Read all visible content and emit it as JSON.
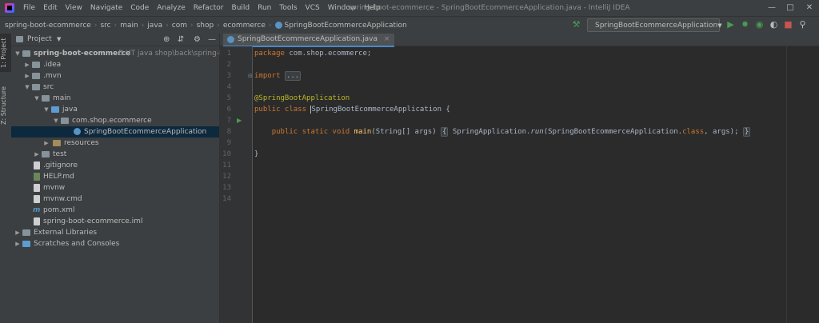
{
  "menu": [
    "File",
    "Edit",
    "View",
    "Navigate",
    "Code",
    "Analyze",
    "Refactor",
    "Build",
    "Run",
    "Tools",
    "VCS",
    "Window",
    "Help"
  ],
  "window_title": "spring-boot-ecommerce - SpringBootEcommerceApplication.java - IntelliJ IDEA",
  "breadcrumbs": [
    "spring-boot-ecommerce",
    "src",
    "main",
    "java",
    "com",
    "shop",
    "ecommerce",
    "SpringBootEcommerceApplication"
  ],
  "run_config": "SpringBootEcommerceApplication",
  "side_tabs": {
    "project": "1: Project",
    "structure": "Z: Structure"
  },
  "project_panel": {
    "title": "Project",
    "tree": [
      {
        "label": "spring-boot-ecommerce",
        "path": "D:\\IT java shop\\back\\spring-boot"
      },
      {
        "label": ".idea"
      },
      {
        "label": ".mvn"
      },
      {
        "label": "src"
      },
      {
        "label": "main"
      },
      {
        "label": "java"
      },
      {
        "label": "com.shop.ecommerce"
      },
      {
        "label": "SpringBootEcommerceApplication"
      },
      {
        "label": "resources"
      },
      {
        "label": "test"
      },
      {
        "label": ".gitignore"
      },
      {
        "label": "HELP.md"
      },
      {
        "label": "mvnw"
      },
      {
        "label": "mvnw.cmd"
      },
      {
        "label": "pom.xml"
      },
      {
        "label": "spring-boot-ecommerce.iml"
      },
      {
        "label": "External Libraries"
      },
      {
        "label": "Scratches and Consoles"
      }
    ]
  },
  "editor": {
    "tab_label": "SpringBootEcommerceApplication.java",
    "line_numbers": [
      "1",
      "2",
      "3",
      "4",
      "5",
      "6",
      "7",
      "8",
      "9",
      "10",
      "11",
      "12",
      "13",
      "14"
    ],
    "code": {
      "l1_kw": "package",
      "l1_rest": " com.shop.ecommerce;",
      "l3_kw": "import",
      "l3_fold": "...",
      "l5_ann": "@SpringBootApplication",
      "l7_kw": "public class",
      "l7_name": "SpringBootEcommerceApplication",
      "l7_brace": " {",
      "l9_kw": "public static void",
      "l9_fn": "main",
      "l9_args": "(String[] args)",
      "l9_open": "{",
      "l9_body1": " SpringApplication.",
      "l9_run": "run",
      "l9_body2": "(SpringBootEcommerceApplication.",
      "l9_class": "class",
      "l9_body3": ", args); ",
      "l9_close": "}",
      "l11_brace": "}"
    }
  },
  "colors": {
    "keyword": "#cc7832",
    "annotation": "#bbb529",
    "function": "#ffc66d",
    "text": "#a9b7c6",
    "selection": "#0d293e",
    "run": "#499c54"
  }
}
